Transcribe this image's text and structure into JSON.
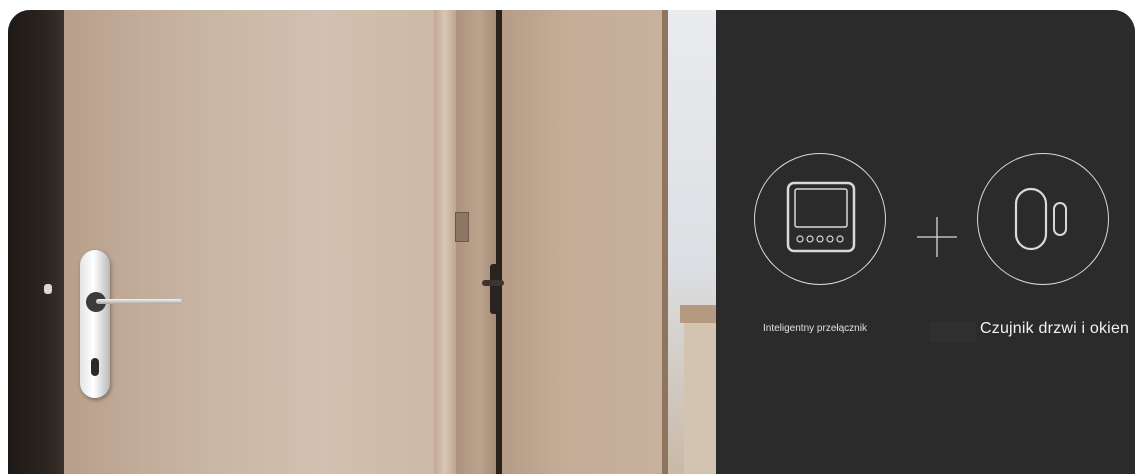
{
  "products": {
    "switch": {
      "icon": "smart-switch-icon",
      "label": "Inteligentny przełącznik"
    },
    "sensor": {
      "icon": "door-window-sensor-icon",
      "label": "Czujnik drzwi i okien"
    },
    "connector_icon": "plus-icon"
  },
  "colors": {
    "panel_background": "#2b2b2b",
    "outline": "#d9d9d9",
    "label_text": "#f2f2f2"
  }
}
